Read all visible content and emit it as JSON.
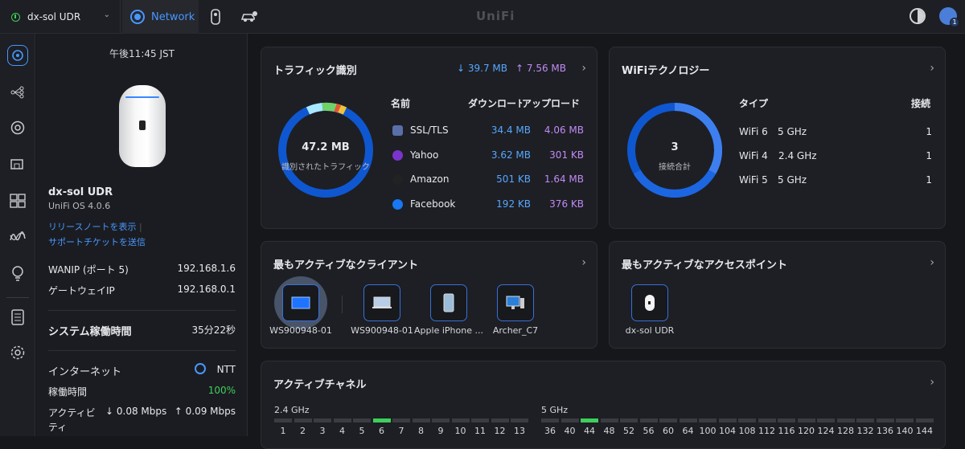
{
  "topbar": {
    "site_name": "dx-sol UDR",
    "network_tab": "Network",
    "logo": "UniFi",
    "avatar_badge": "1"
  },
  "sidebar": {
    "time": "午後11:45 JST",
    "device_name": "dx-sol UDR",
    "device_os": "UniFi OS 4.0.6",
    "release_notes": "リリースノートを表示",
    "release_sep": "|",
    "support": "サポートチケットを送信",
    "wan_label": "WANIP (ポート 5)",
    "wan_value": "192.168.1.6",
    "gateway_label": "ゲートウェイIP",
    "gateway_value": "192.168.0.1",
    "uptime_label": "システム稼働時間",
    "uptime_value": "35分22秒",
    "internet_label": "インターネット",
    "internet_value": "NTT",
    "internet_uptime_label": "稼働時間",
    "internet_uptime_value": "100%",
    "active_label": "アクティビティ",
    "active_down": "↓ 0.08 Mbps",
    "active_up": "↑ 0.09 Mbps"
  },
  "traffic": {
    "title": "トラフィック識別",
    "down": "↓ 39.7 MB",
    "up": "↑ 7.56 MB",
    "total": "47.2 MB",
    "total_label": "識別されたトラフィック",
    "col_name": "名前",
    "col_down": "ダウンロード",
    "col_up": "アップロード",
    "rows": [
      {
        "name": "SSL/TLS",
        "down": "34.4 MB",
        "up": "4.06 MB"
      },
      {
        "name": "Yahoo",
        "down": "3.62 MB",
        "up": "301 KB"
      },
      {
        "name": "Amazon",
        "down": "501 KB",
        "up": "1.64 MB"
      },
      {
        "name": "Facebook",
        "down": "192 KB",
        "up": "376 KB"
      }
    ]
  },
  "wifi": {
    "title": "WiFiテクノロジー",
    "count": "3",
    "count_label": "接続合計",
    "col_type": "タイプ",
    "col_conn": "接続",
    "rows": [
      {
        "type": "WiFi 6",
        "band": "5 GHz",
        "count": "1"
      },
      {
        "type": "WiFi 4",
        "band": "2.4 GHz",
        "count": "1"
      },
      {
        "type": "WiFi 5",
        "band": "5 GHz",
        "count": "1"
      }
    ]
  },
  "clients": {
    "title": "最もアクティブなクライアント",
    "items": [
      "WS900948-01",
      "WS900948-01",
      "Apple iPhone ...",
      "Archer_C7"
    ]
  },
  "aps": {
    "title": "最もアクティブなアクセスポイント",
    "items": [
      "dx-sol UDR"
    ]
  },
  "channels": {
    "title": "アクティブチャネル",
    "band24": "2.4 GHz",
    "band5": "5 GHz",
    "ch24": [
      "1",
      "2",
      "3",
      "4",
      "5",
      "6",
      "7",
      "8",
      "9",
      "10",
      "11",
      "12",
      "13"
    ],
    "active24": "6",
    "ch5": [
      "36",
      "40",
      "44",
      "48",
      "52",
      "56",
      "60",
      "64",
      "100",
      "104",
      "108",
      "112",
      "116",
      "120",
      "124",
      "128",
      "132",
      "136",
      "140",
      "144"
    ],
    "active5": "44"
  },
  "colors": {
    "accent": "#4797ff",
    "active_channel": "#3ecf5a",
    "download": "#58a6ff",
    "upload": "#c18af5"
  }
}
